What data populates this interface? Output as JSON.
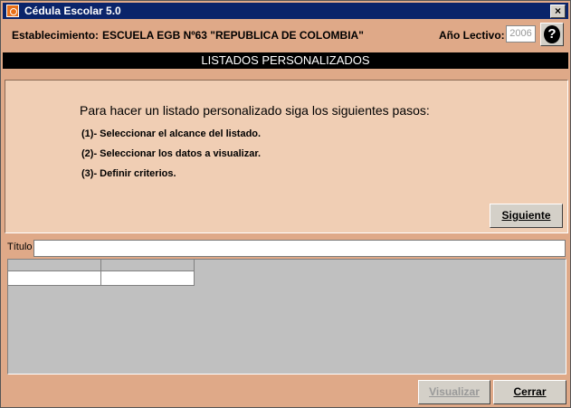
{
  "window": {
    "title": "Cédula Escolar 5.0",
    "icon": "app-icon",
    "close_glyph": "×"
  },
  "info": {
    "establecimiento_label": "Establecimiento:",
    "establecimiento_value": "ESCUELA EGB Nº63 \"REPUBLICA DE COLOMBIA\"",
    "anio_label": "Año Lectivo:",
    "anio_value": "2006",
    "help_glyph": "?"
  },
  "section": {
    "title": "LISTADOS PERSONALIZADOS"
  },
  "panel": {
    "heading": "Para hacer un listado personalizado siga los siguientes pasos:",
    "steps": [
      "(1)- Seleccionar el alcance del listado.",
      "(2)- Seleccionar los datos a visualizar.",
      "(3)- Definir criterios."
    ],
    "next_button": "Siguiente"
  },
  "titulo": {
    "label": "Título",
    "value": ""
  },
  "footer": {
    "visualizar_button": "Visualizar",
    "cerrar_button": "Cerrar"
  },
  "colors": {
    "titlebar": "#0a246a",
    "background": "#dfa988",
    "panel": "#f0ceb4",
    "section_header": "#000000"
  }
}
